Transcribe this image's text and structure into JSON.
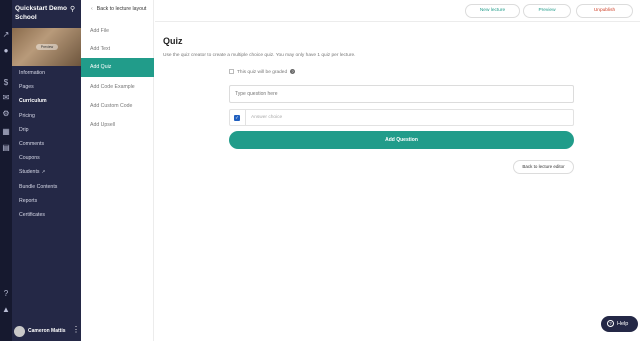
{
  "school": {
    "name": "Quickstart Demo School",
    "thumbnail_badge": "Preview"
  },
  "rail_icons": [
    "chart-icon",
    "users-icon",
    "dollar-icon",
    "mail-icon",
    "gear-icon",
    "library-icon",
    "calendar-icon",
    "help-circle-icon",
    "graduation-icon"
  ],
  "sidebar": {
    "items": [
      {
        "label": "Information"
      },
      {
        "label": "Pages"
      },
      {
        "label": "Curriculum"
      },
      {
        "label": "Pricing"
      },
      {
        "label": "Drip"
      },
      {
        "label": "Comments"
      },
      {
        "label": "Coupons"
      },
      {
        "label": "Students"
      },
      {
        "label": "Bundle Contents"
      },
      {
        "label": "Reports"
      },
      {
        "label": "Certificates"
      }
    ],
    "active": "Curriculum",
    "user_name": "Cameron Mattis"
  },
  "panel": {
    "back_label": "Back to lecture layout",
    "items": [
      {
        "label": "Add File"
      },
      {
        "label": "Add Text"
      },
      {
        "label": "Add Quiz"
      },
      {
        "label": "Add Code Example"
      },
      {
        "label": "Add Custom Code"
      },
      {
        "label": "Add Upsell"
      }
    ],
    "active": "Add Quiz"
  },
  "topbar": {
    "new_lecture": "New lecture",
    "preview": "Preview",
    "unpublish": "Unpublish"
  },
  "quiz": {
    "title": "Quiz",
    "description": "Use the quiz creator to create a multiple choice quiz. You may only have 1 quiz per lecture.",
    "graded_label": "This quiz will be graded",
    "question_placeholder": "Type question here",
    "answer_placeholder": "Answer choice",
    "add_question": "Add Question",
    "back_to_editor": "Back to lecture editor"
  },
  "help": {
    "label": "Help"
  },
  "colors": {
    "accent": "#219c8a",
    "sidebar": "#242846",
    "rail": "#16192f",
    "unpublish": "#d0432b"
  }
}
